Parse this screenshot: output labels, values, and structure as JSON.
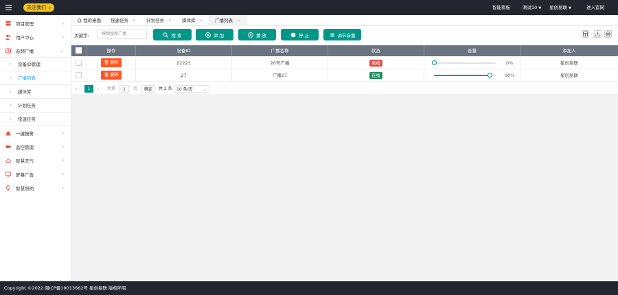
{
  "topbar": {
    "follow_label": "关注我们",
    "links": [
      "智能看板",
      "测试10",
      "星创易联",
      "进入官网"
    ]
  },
  "sidebar": {
    "items": [
      {
        "label": "项目管理",
        "icon": "server-icon"
      },
      {
        "label": "用户中心",
        "icon": "users-icon"
      },
      {
        "label": "音频广播",
        "icon": "broadcast-icon"
      },
      {
        "label": "设备ID管理"
      },
      {
        "label": "广播列表"
      },
      {
        "label": "媒体库"
      },
      {
        "label": "计划任务"
      },
      {
        "label": "快速任务"
      },
      {
        "label": "一键报警",
        "icon": "alarm-icon"
      },
      {
        "label": "监控管理",
        "icon": "camera-icon"
      },
      {
        "label": "智慧天气",
        "icon": "cloud-icon"
      },
      {
        "label": "屏幕广告",
        "icon": "monitor-icon"
      },
      {
        "label": "智慧照明",
        "icon": "bulb-icon"
      }
    ]
  },
  "tabs": [
    "我的桌面",
    "快速任务",
    "计划任务",
    "媒体库",
    "广播列表"
  ],
  "search": {
    "label": "关键字:",
    "placeholder": "模糊搜索广播"
  },
  "toolbar": {
    "search": "搜 索",
    "add": "添 加",
    "play": "播 放",
    "stop": "停 止",
    "volume": "调节音量"
  },
  "table": {
    "headers": [
      "操作",
      "设备ID",
      "广播名称",
      "状态",
      "音量",
      "添加人"
    ],
    "delete_label": "删除",
    "rows": [
      {
        "device_id": "22221",
        "name": "20号广播",
        "status": "离线",
        "status_color": "#e04b45",
        "volume": 0,
        "volume_text": "0%",
        "added_by": "星创易联"
      },
      {
        "device_id": "27",
        "name": "广播27",
        "status": "在线",
        "status_color": "#1e8f5a",
        "volume": 0.9,
        "volume_text": "90%",
        "added_by": "星创易联"
      }
    ]
  },
  "pager": {
    "current": "1",
    "goto_label": "到第",
    "page_input": "1",
    "page_unit": "页",
    "confirm": "确定",
    "total": "共 2 条",
    "page_size": "10 条/页"
  },
  "footer": "Copyright ©2022 闽ICP备19013662号 星创易联 版权所有",
  "colors": {
    "primary": "#009688",
    "danger": "#ff5722",
    "topbar": "#23262e"
  }
}
